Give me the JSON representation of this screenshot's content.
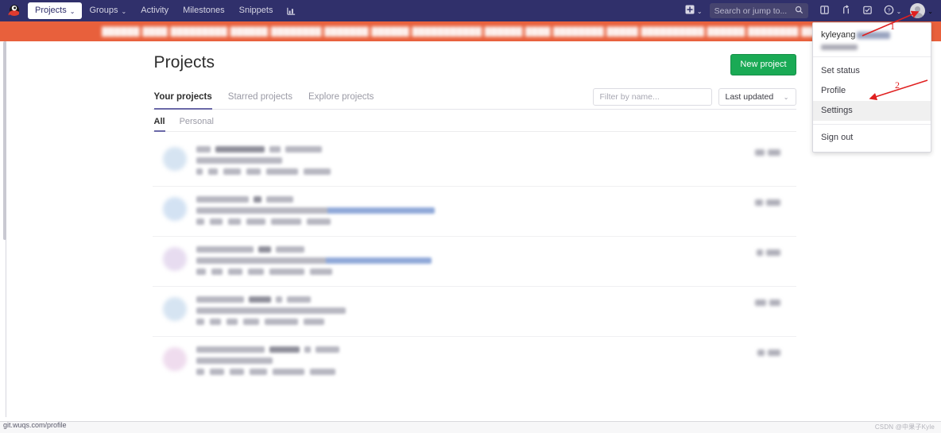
{
  "navbar": {
    "logo_icon": "gitlab-custom-logo-icon",
    "items": [
      {
        "label": "Projects",
        "caret": "⌄",
        "active": true,
        "name": "nav-item-projects"
      },
      {
        "label": "Groups",
        "caret": "⌄",
        "active": false,
        "name": "nav-item-groups"
      },
      {
        "label": "Activity",
        "caret": "",
        "active": false,
        "name": "nav-item-activity"
      },
      {
        "label": "Milestones",
        "caret": "",
        "active": false,
        "name": "nav-item-milestones"
      },
      {
        "label": "Snippets",
        "caret": "",
        "active": false,
        "name": "nav-item-snippets"
      }
    ],
    "chart_icon": "analytics-chart-icon",
    "right": {
      "plus_icon": "plus-square-icon",
      "plus_caret": "⌄",
      "search_placeholder": "Search or jump to...",
      "search_icon": "search-icon",
      "issues_icon": "issues-icon",
      "merge_requests_icon": "merge-request-icon",
      "todos_icon": "todos-checkmark-icon",
      "help_icon": "help-question-icon",
      "help_caret": "⌄",
      "avatar_icon": "user-avatar-icon",
      "avatar_caret": "⌄"
    }
  },
  "banner": {
    "text": "██████ ████ █████████ ██████ ████████ ███████ ██████ ███████████ ██████ ████ ████████ █████ ██████████ ██████ ████████ ██████",
    "background_color": "#e8603c"
  },
  "page": {
    "title": "Projects",
    "new_project_label": "New project",
    "tabs": [
      {
        "label": "Your projects",
        "active": true
      },
      {
        "label": "Starred projects",
        "active": false
      },
      {
        "label": "Explore projects",
        "active": false
      }
    ],
    "subtabs": [
      {
        "label": "All",
        "active": true
      },
      {
        "label": "Personal",
        "active": false
      }
    ],
    "filter_placeholder": "Filter by name...",
    "sort_value": "Last updated",
    "sort_caret": "⌄"
  },
  "projects": [
    {
      "avatar_color": "#d6e4f2",
      "title_widths": [
        18,
        62,
        14,
        46
      ],
      "desc_width": 108,
      "meta_widths": [
        8,
        12,
        22,
        18,
        40,
        34
      ],
      "stat_widths": [
        12,
        16
      ],
      "link_line": false
    },
    {
      "avatar_color": "#d3e2f3",
      "title_widths": [
        66,
        10,
        34
      ],
      "desc_width": 300,
      "meta_widths": [
        10,
        16,
        16,
        24,
        38,
        30
      ],
      "stat_widths": [
        10,
        18
      ],
      "link_line": true
    },
    {
      "avatar_color": "#e7dcf0",
      "title_widths": [
        72,
        16,
        36
      ],
      "desc_width": 296,
      "meta_widths": [
        12,
        14,
        18,
        20,
        44,
        28
      ],
      "stat_widths": [
        8,
        18
      ],
      "link_line": true
    },
    {
      "avatar_color": "#d6e4f2",
      "title_widths": [
        60,
        28,
        8,
        30
      ],
      "desc_width": 188,
      "meta_widths": [
        10,
        14,
        14,
        20,
        42,
        26
      ],
      "stat_widths": [
        14,
        14
      ],
      "link_line": false
    },
    {
      "avatar_color": "#efdcee",
      "title_widths": [
        86,
        38,
        8,
        30
      ],
      "desc_width": 96,
      "meta_widths": [
        10,
        18,
        18,
        22,
        40,
        32
      ],
      "stat_widths": [
        9,
        16
      ],
      "link_line": false
    }
  ],
  "user_dropdown": {
    "username": "kyleyang",
    "items": [
      {
        "label": "Set status",
        "hover": false
      },
      {
        "label": "Profile",
        "hover": false
      },
      {
        "label": "Settings",
        "hover": true
      },
      {
        "label": "Sign out",
        "hover": false
      }
    ]
  },
  "annotations": [
    {
      "number": "1",
      "color": "#e02020"
    },
    {
      "number": "2",
      "color": "#e02020"
    }
  ],
  "statusbar": {
    "url": "git.wuqs.com/profile",
    "watermark": "CSDN @中果子Kyle"
  }
}
